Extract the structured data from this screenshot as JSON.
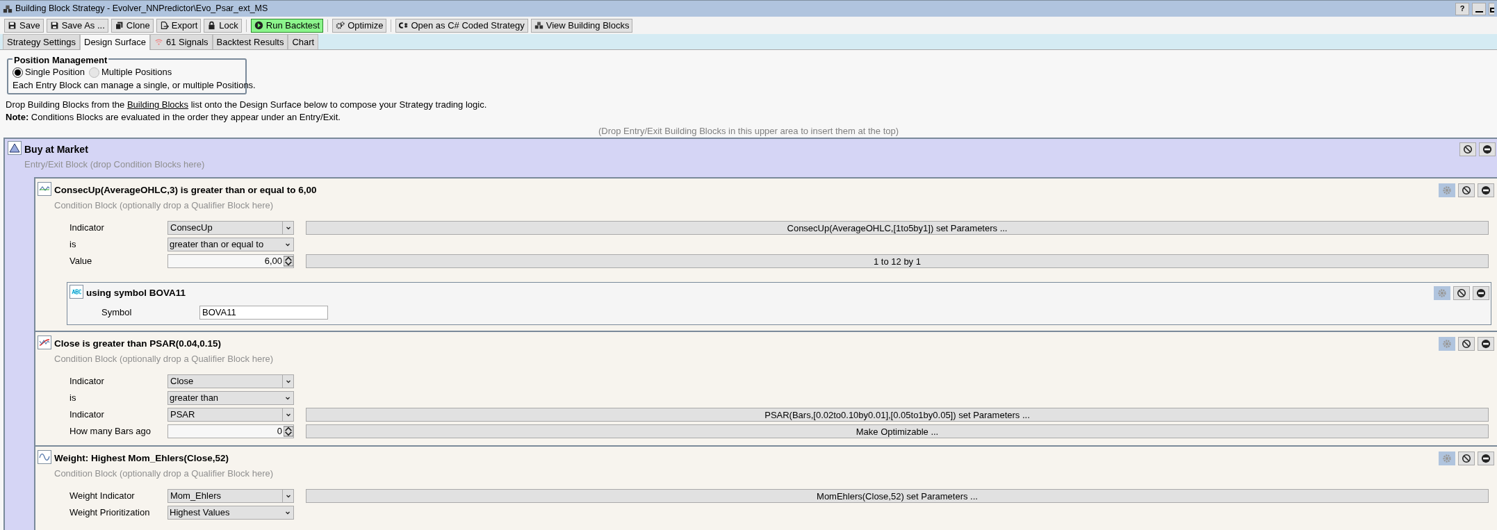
{
  "window": {
    "title": "Building Block Strategy - Evolver_NNPredictor\\Evo_Psar_ext_MS",
    "help": "?"
  },
  "toolbar": [
    {
      "label": "Save",
      "kind": "normal"
    },
    {
      "label": "Save As ...",
      "kind": "normal"
    },
    {
      "label": "Clone",
      "kind": "normal"
    },
    {
      "label": "Export",
      "kind": "normal"
    },
    {
      "label": "Lock",
      "kind": "normal"
    },
    {
      "label": "Run Backtest",
      "kind": "primary"
    },
    {
      "label": "Optimize",
      "kind": "normal"
    },
    {
      "label": "Open as C# Coded Strategy",
      "kind": "normal"
    },
    {
      "label": "View Building Blocks",
      "kind": "normal"
    }
  ],
  "tabs": [
    {
      "label": "Strategy Settings",
      "selected": false
    },
    {
      "label": "Design Surface",
      "selected": true
    },
    {
      "label": "61 Signals",
      "selected": false
    },
    {
      "label": "Backtest Results",
      "selected": false
    },
    {
      "label": "Chart",
      "selected": false
    }
  ],
  "position_management": {
    "title": "Position Management",
    "options": [
      {
        "label": "Single Position",
        "selected": true
      },
      {
        "label": "Multiple Positions",
        "selected": false
      }
    ],
    "note": "Each Entry Block can manage a single, or multiple Positions."
  },
  "instructions": {
    "before": "Drop Building Blocks from the",
    "link": "Building Blocks",
    "after": "list onto the Design Surface below to compose your Strategy trading logic.",
    "note": "**Note:** Conditions Blocks are evaluated in the order they appear under an Entry/Exit."
  },
  "drop_hint": "(Drop Entry/Exit Building Blocks in this upper area to insert them at the top)",
  "entry_block": {
    "title": "Buy at Market",
    "subtitle": "Entry/Exit Block (drop Condition Blocks here)",
    "conditions": [
      {
        "title": "ConsecUp(AverageOHLC,3) is greater than or equal to 6,00",
        "subtitle": "Condition Block (optionally drop a Qualifier Block here)",
        "fields": [
          {
            "label": "Indicator",
            "kind": "combo",
            "value": "ConsecUp",
            "side_button": "ConsecUp(AverageOHLC,[1to5by1]) set Parameters ..."
          },
          {
            "label": "is",
            "kind": "dropdown",
            "value": "greater than or equal to"
          },
          {
            "label": "Value",
            "kind": "spinner",
            "value": "6,00",
            "side_button": "1 to 12 by 1"
          }
        ],
        "qualifiers": [
          {
            "title": "using symbol BOVA11",
            "fields": [
              {
                "label": "Symbol",
                "kind": "text",
                "value": "BOVA11"
              }
            ]
          }
        ]
      },
      {
        "title": "Close is greater than PSAR(0.04,0.15)",
        "subtitle": "Condition Block (optionally drop a Qualifier Block here)",
        "fields": [
          {
            "label": "Indicator",
            "kind": "combo",
            "value": "Close"
          },
          {
            "label": "is",
            "kind": "dropdown",
            "value": "greater than"
          },
          {
            "label": "Indicator",
            "kind": "combo",
            "value": "PSAR",
            "side_button": "PSAR(Bars,[0.02to0.10by0.01],[0.05to1by0.05]) set Parameters ..."
          },
          {
            "label": "How many Bars ago",
            "kind": "spinner",
            "value": "0",
            "side_button": "Make Optimizable ..."
          }
        ]
      },
      {
        "title": "Weight: Highest Mom_Ehlers(Close,52)",
        "subtitle": "Condition Block (optionally drop a Qualifier Block here)",
        "fields": [
          {
            "label": "Weight Indicator",
            "kind": "combo",
            "value": "Mom_Ehlers",
            "side_button": "MomEhlers(Close,52) set Parameters ..."
          },
          {
            "label": "Weight Prioritization",
            "kind": "dropdown",
            "value": "Highest Values"
          }
        ]
      }
    ]
  }
}
